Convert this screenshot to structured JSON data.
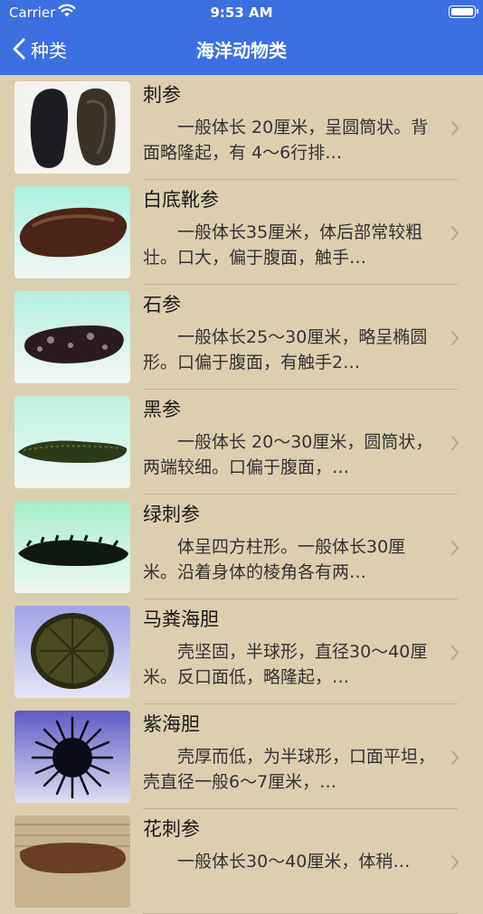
{
  "status_bar": {
    "carrier": "Carrier",
    "time": "9:53 AM"
  },
  "nav": {
    "back_label": "种类",
    "title": "海洋动物类"
  },
  "items": [
    {
      "name": "刺参",
      "desc": "一般体长 20厘米，呈圆筒状。背面略隆起，有 4～6行排…"
    },
    {
      "name": "白底靴参",
      "desc": "一般体长35厘米，体后部常较粗壮。口大，偏于腹面，触手…"
    },
    {
      "name": "石参",
      "desc": "一般体长25～30厘米，略呈椭圆形。口偏于腹面，有触手2…"
    },
    {
      "name": "黑参",
      "desc": "一般体长 20～30厘米，圆筒状，两端较细。口偏于腹面，…"
    },
    {
      "name": "绿刺参",
      "desc": "体呈四方柱形。一般体长30厘米。沿着身体的棱角各有两…"
    },
    {
      "name": "马粪海胆",
      "desc": "壳坚固，半球形，直径30～40厘米。反口面低，略隆起，…"
    },
    {
      "name": "紫海胆",
      "desc": "壳厚而低，为半球形，口面平坦，壳直径一般6～7厘米，…"
    },
    {
      "name": "花刺参",
      "desc": "一般体长30～40厘米，体稍…"
    }
  ]
}
